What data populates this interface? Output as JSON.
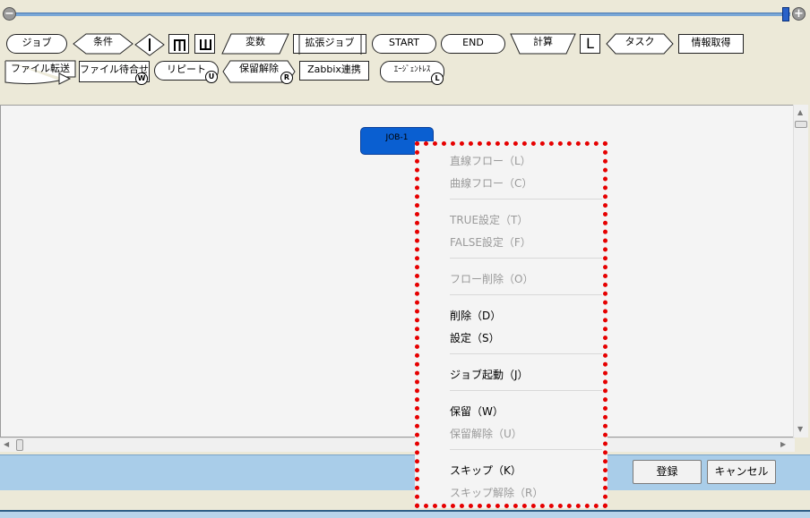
{
  "toolbar": {
    "zoom_out": "−",
    "zoom_in": "+",
    "row1": {
      "job": "ジョブ",
      "condition": "条件",
      "variable": "変数",
      "ext_job": "拡張ジョブ",
      "start": "START",
      "end": "END",
      "calc": "計算",
      "loop": "L",
      "task": "タスク",
      "info": "情報取得"
    },
    "row2": {
      "file_transfer": "ファイル転送",
      "file_wait": "ファイル待合せ",
      "repeat": "リピート",
      "hold_release": "保留解除",
      "zabbix": "Zabbix連携",
      "agentless": "ｴｰｼﾞｪﾝﾄﾚｽ"
    },
    "badges": {
      "file_wait": "W",
      "repeat": "U",
      "hold_release": "R",
      "agentless": "L"
    }
  },
  "canvas": {
    "job_node": "JOB-1"
  },
  "context_menu": {
    "straight_flow": "直線フロー（L）",
    "curved_flow": "曲線フロー（C）",
    "true_set": "TRUE設定（T）",
    "false_set": "FALSE設定（F）",
    "flow_delete": "フロー削除（O）",
    "delete": "削除（D）",
    "settings": "設定（S）",
    "job_start": "ジョブ起動（J）",
    "hold": "保留（W）",
    "hold_release": "保留解除（U）",
    "skip": "スキップ（K）",
    "skip_release": "スキップ解除（R）"
  },
  "footer": {
    "register": "登録",
    "cancel": "キャンセル"
  },
  "colors": {
    "highlight": "#e60000",
    "job_node": "#0a5fd1",
    "bottom_bar": "#a9cde9"
  }
}
